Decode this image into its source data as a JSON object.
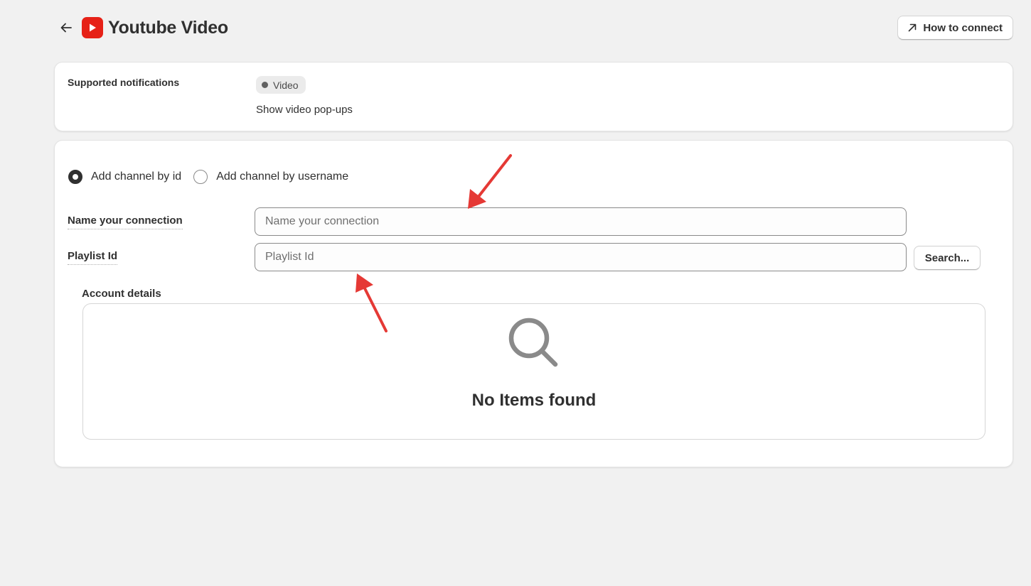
{
  "header": {
    "title": "Youtube Video",
    "back_icon": "arrow-left-icon",
    "logo_icon": "youtube-play-icon",
    "how_to_connect_label": "How to connect",
    "how_to_connect_icon": "external-arrow-icon"
  },
  "notifications": {
    "label": "Supported notifications",
    "badge": "Video",
    "description": "Show video pop-ups"
  },
  "channel": {
    "options": [
      {
        "label": "Add channel by id",
        "checked": true
      },
      {
        "label": "Add channel by username",
        "checked": false
      }
    ]
  },
  "form": {
    "name_label": "Name your connection",
    "name_value": "",
    "name_placeholder": "Name your connection",
    "playlist_label": "Playlist Id",
    "playlist_value": "",
    "playlist_placeholder": "Playlist Id",
    "search_label": "Search..."
  },
  "account": {
    "label": "Account details",
    "empty_icon": "search-icon",
    "empty_text": "No Items found"
  },
  "colors": {
    "background": "#f1f1f1",
    "card": "#ffffff",
    "text": "#303030",
    "youtube_red": "#e62117",
    "annotation_arrow": "#e53935",
    "muted_icon": "#8a8a8a"
  }
}
